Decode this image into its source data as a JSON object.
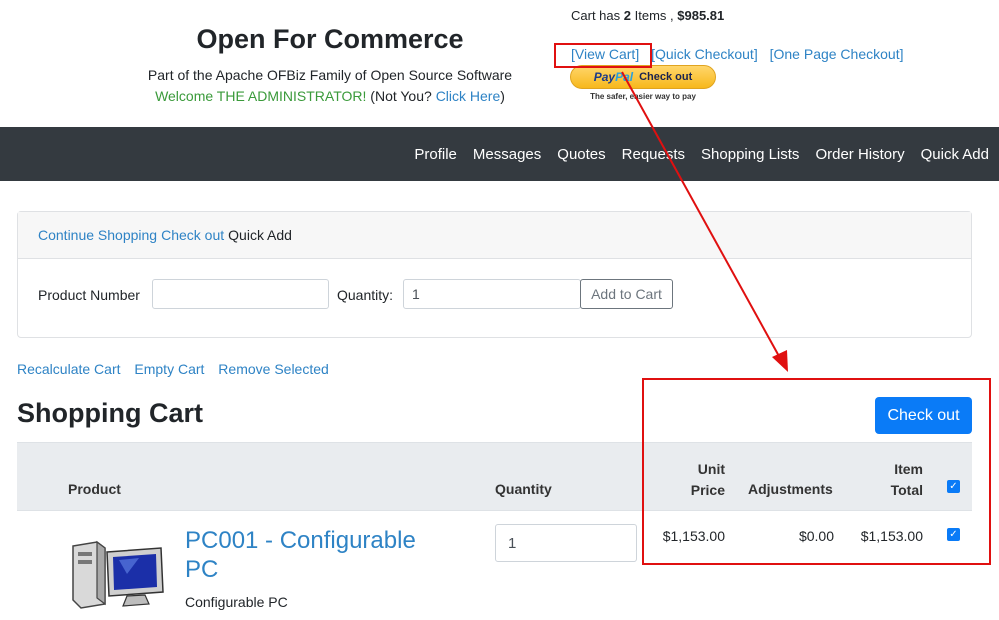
{
  "header": {
    "title": "Open For Commerce",
    "subtitle": "Part of the Apache OFBiz Family of Open Source Software",
    "welcome": "Welcome THE ADMINISTRATOR!",
    "not_you": "(Not You?",
    "click_here": "Click Here",
    "close_paren": ")"
  },
  "cart_summary": {
    "prefix": "Cart has",
    "count": "2",
    "items_label": "Items ,",
    "total": "$985.81"
  },
  "cart_links": {
    "view_cart": "[View Cart]",
    "quick_checkout": "[Quick Checkout]",
    "one_page_checkout": "[One Page Checkout]"
  },
  "paypal": {
    "pay": "Pay",
    "pal": "Pal",
    "check_out": "Check out",
    "tagline": "The safer, easier way to pay"
  },
  "nav": {
    "items": [
      "Profile",
      "Messages",
      "Quotes",
      "Requests",
      "Shopping Lists",
      "Order History",
      "Quick Add"
    ]
  },
  "quick_add": {
    "continue_shopping": "Continue Shopping",
    "check_out": "Check out",
    "title": "Quick Add",
    "product_number_label": "Product Number",
    "product_number_value": "",
    "quantity_label": "Quantity:",
    "quantity_value": "1",
    "add_button": "Add to Cart"
  },
  "cart_actions": {
    "recalculate": "Recalculate Cart",
    "empty": "Empty Cart",
    "remove_selected": "Remove Selected"
  },
  "cart": {
    "title": "Shopping Cart",
    "checkout_button": "Check out",
    "columns": {
      "product": "Product",
      "quantity": "Quantity",
      "unit_line1": "Unit",
      "unit_line2": "Price",
      "adjustments": "Adjustments",
      "total_line1": "Item",
      "total_line2": "Total"
    },
    "header_checkbox_checked": true,
    "rows": [
      {
        "name": "PC001 - Configurable PC",
        "description": "Configurable PC",
        "quantity": "1",
        "unit_price": "$1,153.00",
        "adjustments": "$0.00",
        "item_total": "$1,153.00",
        "checked": true,
        "icon": "desktop-computer-icon"
      }
    ]
  },
  "colors": {
    "link": "#2e83c5",
    "navbar": "#343a40",
    "primary": "#0a7bf7",
    "welcome": "#3a9a3a",
    "annotation": "#e01010"
  }
}
